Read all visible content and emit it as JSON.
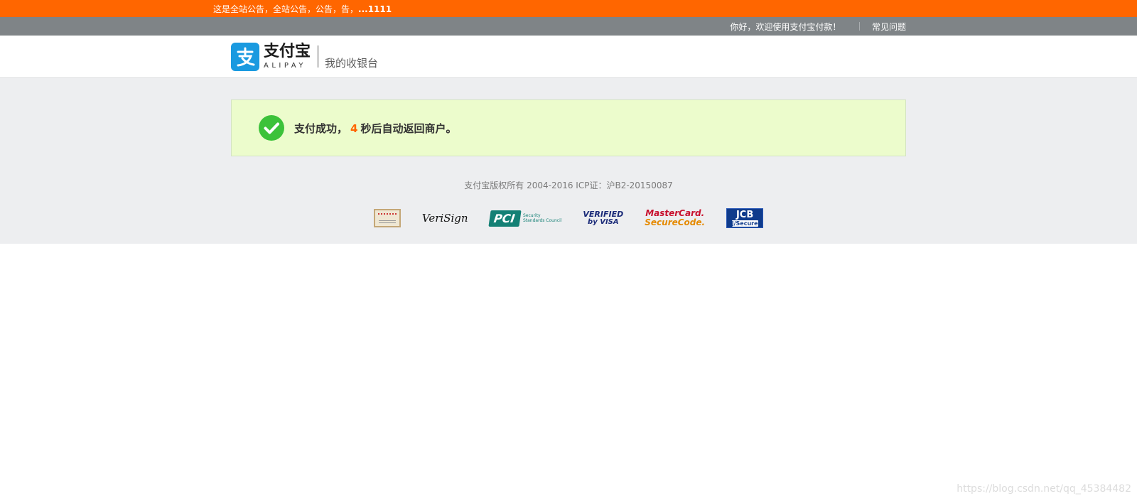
{
  "notice": {
    "text": "这是全站公告，全站公告，公告，告，",
    "suffix": "...1111"
  },
  "topnav": {
    "welcome": "你好，欢迎使用支付宝付款！",
    "help_link": "常见问题"
  },
  "header": {
    "logo_cn": "支付宝",
    "logo_en": "ALIPAY",
    "cashier_title": "我的收银台"
  },
  "result": {
    "prefix": "支付成功，",
    "countdown": "4",
    "suffix": "秒后自动返回商户。"
  },
  "footer": {
    "copyright": "支付宝版权所有 2004-2016 ICP证：沪B2-20150087",
    "badges": {
      "verisign": "VeriSign",
      "pci": "PCI",
      "pci_sub_1": "Security",
      "pci_sub_2": "Standards Council",
      "vbv_top": "VERIFIED",
      "vbv_bot": "by VISA",
      "mc_top": "MasterCard.",
      "mc_bot": "SecureCode.",
      "jcb_top": "JCB",
      "jcb_bot": "J/Secure"
    }
  },
  "watermark": "https://blog.csdn.net/qq_45384482",
  "colors": {
    "notice_bg": "#ff6600",
    "topnav_bg": "#7f8487",
    "accent_orange": "#ff6600",
    "success_bg": "#ecfccc",
    "success_green": "#3cc23a",
    "alipay_blue": "#1a9ae0"
  }
}
